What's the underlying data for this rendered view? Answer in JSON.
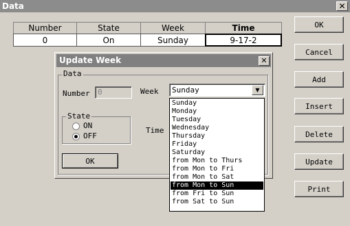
{
  "window": {
    "title": "Data",
    "close": "✕"
  },
  "table": {
    "headers": [
      "Number",
      "State",
      "Week",
      "Time"
    ],
    "row": [
      "0",
      "On",
      "Sunday",
      "9-17-2"
    ]
  },
  "buttons": [
    "OK",
    "Cancel",
    "Add",
    "Insert",
    "Delete",
    "Update",
    "Print"
  ],
  "dialog": {
    "title": "Update Week",
    "close": "✕",
    "group_label": "Data",
    "number_label": "Number",
    "number_value": "0",
    "week_label": "Week",
    "week_value": "Sunday",
    "state_label": "State",
    "state_on": "ON",
    "state_off": "OFF",
    "state_selected": "OFF",
    "time_label": "Time",
    "ok_label": "OK"
  },
  "week_options": [
    "Sunday",
    "Monday",
    "Tuesday",
    "Wednesday",
    "Thursday",
    "Friday",
    "Saturday",
    "from Mon to Thurs",
    "from Mon to Fri",
    "from Mon to Sat",
    "from Mon to Sun",
    "from Fri to Sun",
    "from Sat to Sun"
  ],
  "week_highlighted": "from Mon to Sun"
}
